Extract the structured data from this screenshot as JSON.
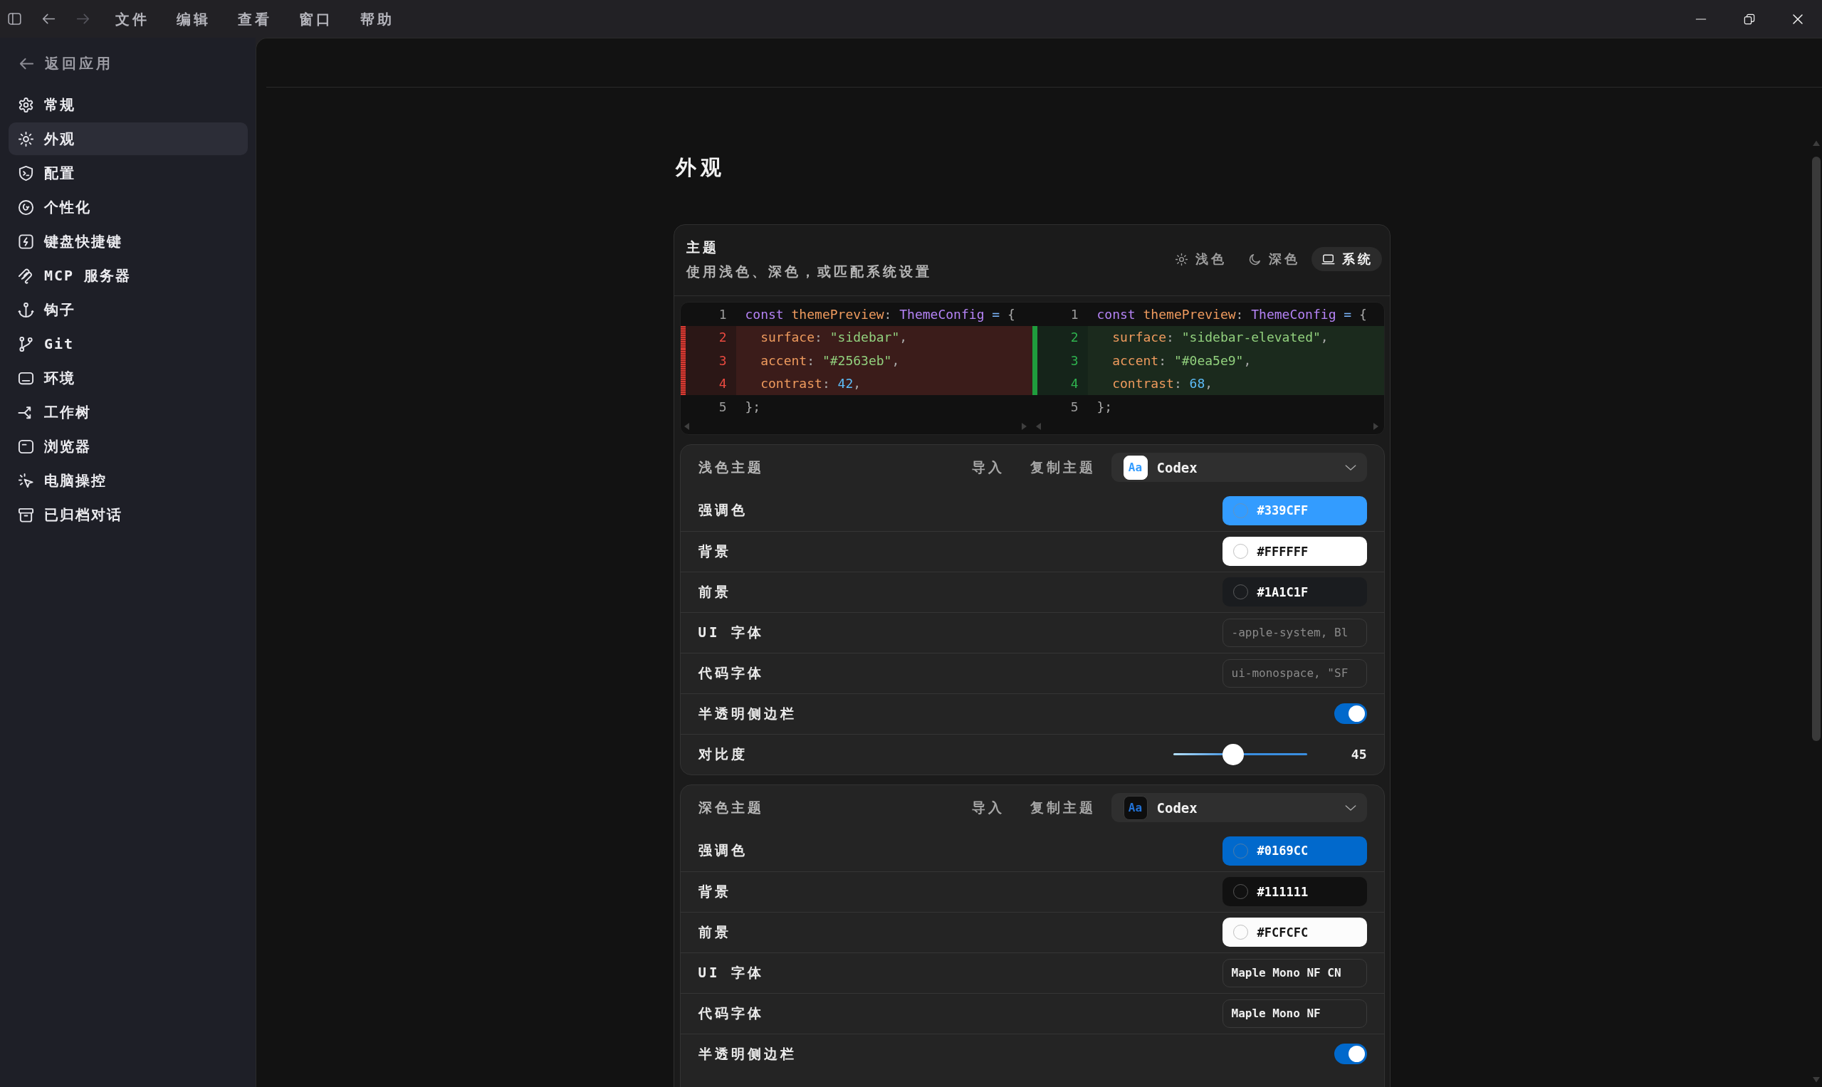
{
  "title_bar": {
    "nav_buttons": [
      {
        "kind": "back",
        "disabled": false
      },
      {
        "kind": "forward",
        "disabled": true
      }
    ],
    "menu": [
      "文件",
      "编辑",
      "查看",
      "窗口",
      "帮助"
    ]
  },
  "sidebar": {
    "back_link": "返回应用",
    "items": [
      {
        "label": "常规",
        "selected": false
      },
      {
        "label": "外观",
        "selected": true
      },
      {
        "label": "配置",
        "selected": false
      },
      {
        "label": "个性化",
        "selected": false
      },
      {
        "label": "键盘快捷键",
        "selected": false
      },
      {
        "label": "MCP 服务器",
        "selected": false
      },
      {
        "label": "钩子",
        "selected": false
      },
      {
        "label": "Git",
        "selected": false
      },
      {
        "label": "环境",
        "selected": false
      },
      {
        "label": "工作树",
        "selected": false
      },
      {
        "label": "浏览器",
        "selected": false
      },
      {
        "label": "电脑操控",
        "selected": false
      },
      {
        "label": "已归档对话",
        "selected": false
      }
    ]
  },
  "page_title": "外观",
  "theme_card": {
    "title": "主题",
    "description": "使用浅色、深色，或匹配系统设置",
    "modes": [
      {
        "label": "浅色",
        "selected": false
      },
      {
        "label": "深色",
        "selected": false
      },
      {
        "label": "系统",
        "selected": true
      }
    ],
    "diff": {
      "panes": [
        {
          "lines": [
            {
              "number": "1",
              "kind": "context",
              "tokens": [
                {
                  "kind": "keyword",
                  "text": "const "
                },
                {
                  "kind": "variable",
                  "text": "themePreview"
                },
                {
                  "kind": "punct",
                  "text": ": "
                },
                {
                  "kind": "type",
                  "text": "ThemeConfig"
                },
                {
                  "kind": "operator",
                  "text": " = "
                },
                {
                  "kind": "punct",
                  "text": "{"
                }
              ]
            },
            {
              "number": "2",
              "kind": "removed",
              "tokens": [
                {
                  "kind": "property",
                  "text": "  surface"
                },
                {
                  "kind": "punct",
                  "text": ": "
                },
                {
                  "kind": "string",
                  "text": "\"sidebar\""
                },
                {
                  "kind": "punct",
                  "text": ","
                }
              ]
            },
            {
              "number": "3",
              "kind": "removed",
              "tokens": [
                {
                  "kind": "property",
                  "text": "  accent"
                },
                {
                  "kind": "punct",
                  "text": ": "
                },
                {
                  "kind": "string",
                  "text": "\"#2563eb\""
                },
                {
                  "kind": "punct",
                  "text": ","
                }
              ]
            },
            {
              "number": "4",
              "kind": "removed",
              "tokens": [
                {
                  "kind": "property",
                  "text": "  contrast"
                },
                {
                  "kind": "punct",
                  "text": ": "
                },
                {
                  "kind": "number",
                  "text": "42"
                },
                {
                  "kind": "punct",
                  "text": ","
                }
              ]
            },
            {
              "number": "5",
              "kind": "context",
              "tokens": [
                {
                  "kind": "punct",
                  "text": "};"
                }
              ]
            }
          ]
        },
        {
          "lines": [
            {
              "number": "1",
              "kind": "context",
              "tokens": [
                {
                  "kind": "keyword",
                  "text": "const "
                },
                {
                  "kind": "variable",
                  "text": "themePreview"
                },
                {
                  "kind": "punct",
                  "text": ": "
                },
                {
                  "kind": "type",
                  "text": "ThemeConfig"
                },
                {
                  "kind": "operator",
                  "text": " = "
                },
                {
                  "kind": "punct",
                  "text": "{"
                }
              ]
            },
            {
              "number": "2",
              "kind": "added",
              "tokens": [
                {
                  "kind": "property",
                  "text": "  surface"
                },
                {
                  "kind": "punct",
                  "text": ": "
                },
                {
                  "kind": "string",
                  "text": "\"sidebar-elevated\""
                },
                {
                  "kind": "punct",
                  "text": ","
                }
              ]
            },
            {
              "number": "3",
              "kind": "added",
              "tokens": [
                {
                  "kind": "property",
                  "text": "  accent"
                },
                {
                  "kind": "punct",
                  "text": ": "
                },
                {
                  "kind": "string",
                  "text": "\"#0ea5e9\""
                },
                {
                  "kind": "punct",
                  "text": ","
                }
              ]
            },
            {
              "number": "4",
              "kind": "added",
              "tokens": [
                {
                  "kind": "property",
                  "text": "  contrast"
                },
                {
                  "kind": "punct",
                  "text": ": "
                },
                {
                  "kind": "number",
                  "text": "68"
                },
                {
                  "kind": "punct",
                  "text": ","
                }
              ]
            },
            {
              "number": "5",
              "kind": "context",
              "tokens": [
                {
                  "kind": "punct",
                  "text": "};"
                }
              ]
            }
          ]
        }
      ]
    }
  },
  "theme_panels": [
    {
      "kind": "light",
      "title": "浅色主题",
      "actions": [
        "导入",
        "复制主题"
      ],
      "preset": {
        "badge": "Aa",
        "name": "Codex"
      },
      "rows": [
        {
          "kind": "color",
          "label": "强调色",
          "value": "#339CFF",
          "color": "#339cff"
        },
        {
          "kind": "color",
          "label": "背景",
          "value": "#FFFFFF",
          "color": "#ffffff"
        },
        {
          "kind": "color",
          "label": "前景",
          "value": "#1A1C1F",
          "color": "#1a1c1f"
        },
        {
          "kind": "font",
          "label": "UI 字体",
          "placeholder": "-apple-system, Bl"
        },
        {
          "kind": "font",
          "label": "代码字体",
          "placeholder": "ui-monospace, \"SF"
        },
        {
          "kind": "toggle",
          "label": "半透明侧边栏",
          "on": true
        },
        {
          "kind": "slider",
          "label": "对比度",
          "level": 0.45,
          "reading": "45"
        }
      ]
    },
    {
      "kind": "dark",
      "title": "深色主题",
      "actions": [
        "导入",
        "复制主题"
      ],
      "preset": {
        "badge": "Aa",
        "name": "Codex"
      },
      "rows": [
        {
          "kind": "color",
          "label": "强调色",
          "value": "#0169CC",
          "color": "#0169cc"
        },
        {
          "kind": "color",
          "label": "背景",
          "value": "#111111",
          "color": "#111111"
        },
        {
          "kind": "color",
          "label": "前景",
          "value": "#FCFCFC",
          "color": "#fcfcfc"
        },
        {
          "kind": "font",
          "label": "UI 字体",
          "value": "Maple Mono NF CN"
        },
        {
          "kind": "font",
          "label": "代码字体",
          "value": "Maple Mono NF"
        },
        {
          "kind": "toggle",
          "label": "半透明侧边栏",
          "on": true
        }
      ]
    }
  ]
}
